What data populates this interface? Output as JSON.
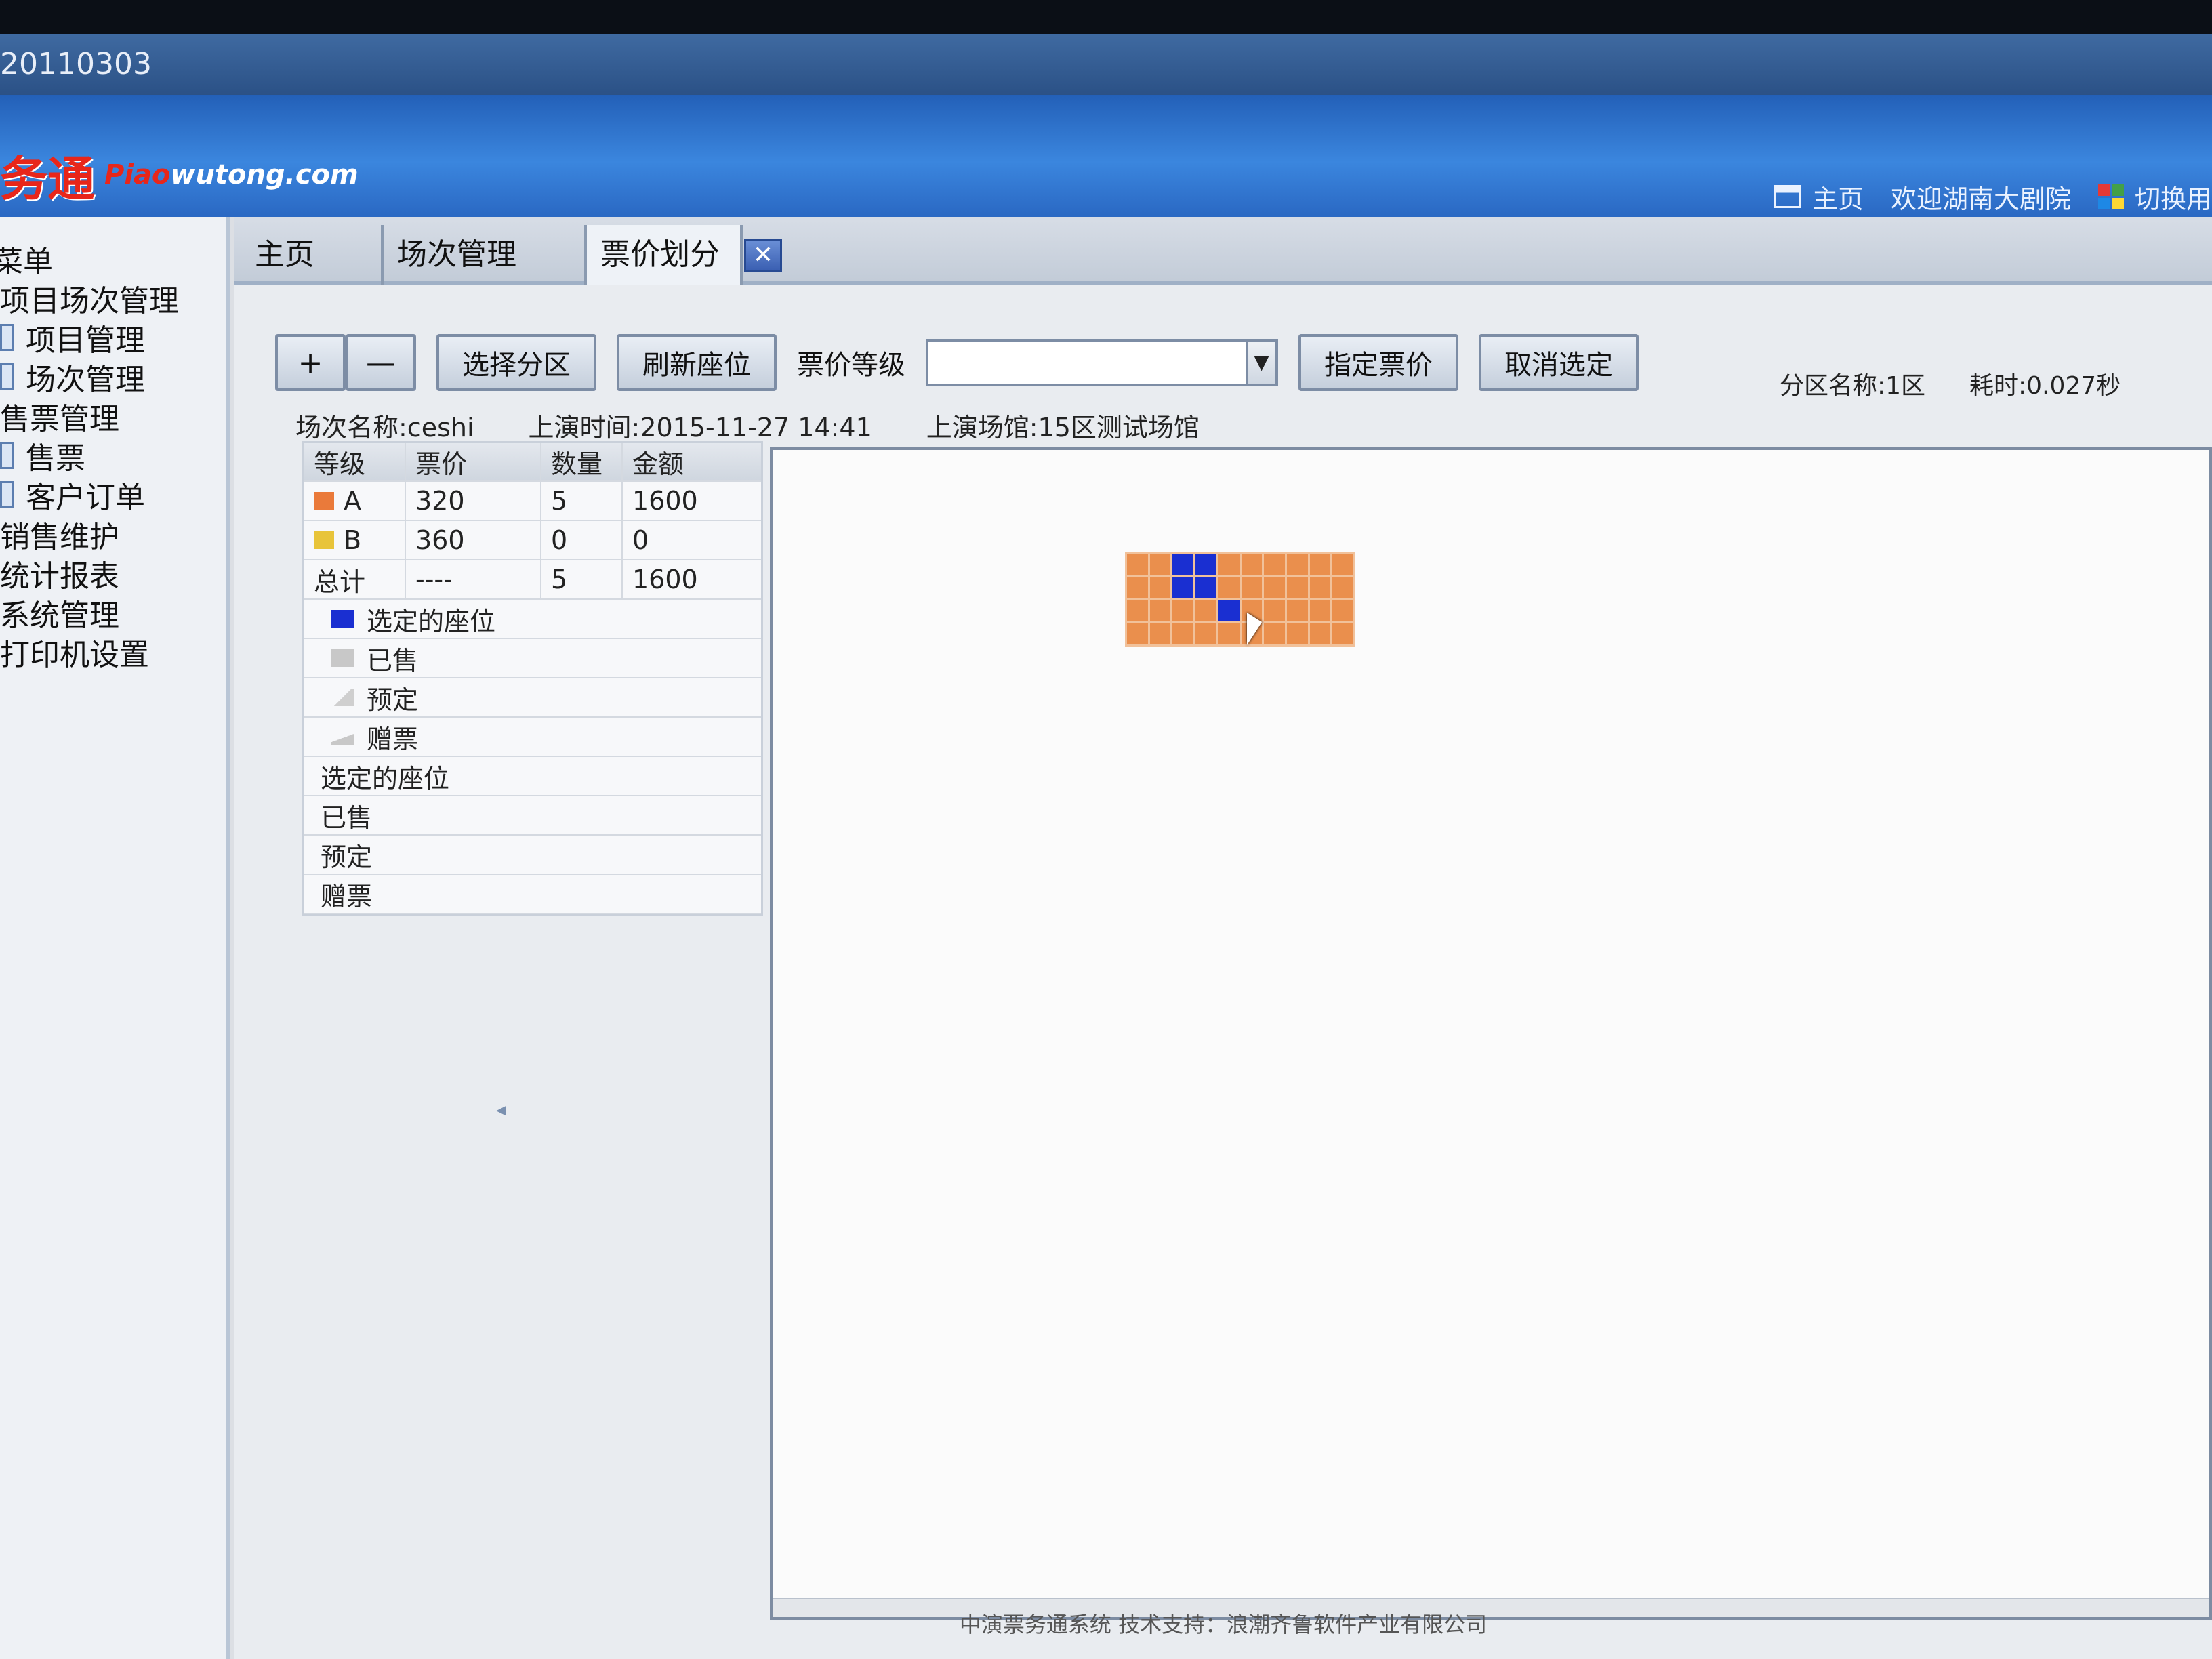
{
  "window": {
    "title": "20110303"
  },
  "brand": {
    "logo_cn": "务通",
    "logo_en_prefix": "Piao",
    "logo_en_rest": "wutong.com"
  },
  "top_nav": {
    "home_label": "主页",
    "welcome": "欢迎湖南大剧院",
    "switch_label": "切换用"
  },
  "sidebar": {
    "items": [
      {
        "label": "菜单"
      },
      {
        "label": "项目场次管理"
      },
      {
        "label": "项目管理"
      },
      {
        "label": "场次管理"
      },
      {
        "label": "售票管理"
      },
      {
        "label": "售票"
      },
      {
        "label": "客户订单"
      },
      {
        "label": "销售维护"
      },
      {
        "label": "统计报表"
      },
      {
        "label": "系统管理"
      },
      {
        "label": "打印机设置"
      }
    ]
  },
  "tabs": [
    {
      "label": "主页"
    },
    {
      "label": "场次管理"
    },
    {
      "label": "票价划分"
    }
  ],
  "toolbar": {
    "plus": "+",
    "minus": "—",
    "select_zone": "选择分区",
    "refresh_seats": "刷新座位",
    "price_level_label": "票价等级",
    "price_level_value": "",
    "assign_price": "指定票价",
    "cancel_selection": "取消选定"
  },
  "status": {
    "zone_name": "分区名称:1区",
    "elapsed": "耗时:0.027秒"
  },
  "session_info": {
    "name": "场次名称:ceshi",
    "time": "上演时间:2015-11-27 14:41",
    "venue": "上演场馆:15区测试场馆"
  },
  "price_table": {
    "headers": [
      "等级",
      "票价",
      "数量",
      "金额"
    ],
    "rows": [
      {
        "level": "A",
        "price": "320",
        "qty": "5",
        "amount": "1600",
        "color": "#ea7a3a"
      },
      {
        "level": "B",
        "price": "360",
        "qty": "0",
        "amount": "0",
        "color": "#e8c43a"
      }
    ],
    "total": {
      "level": "总计",
      "price": "----",
      "qty": "5",
      "amount": "1600"
    }
  },
  "legend": [
    {
      "label": "选定的座位",
      "color": "#1a2fd1"
    },
    {
      "label": "已售",
      "color": "#c8c8c8"
    },
    {
      "label": "预定",
      "color": "#d8d8d8"
    },
    {
      "label": "赠票",
      "color": "#d0d0d0"
    }
  ],
  "legend_plain": [
    "选定的座位",
    "已售",
    "预定",
    "赠票"
  ],
  "seat_map": {
    "rows": 4,
    "cols": 10,
    "selected": [
      [
        0,
        2
      ],
      [
        0,
        3
      ],
      [
        1,
        2
      ],
      [
        1,
        3
      ],
      [
        2,
        4
      ]
    ],
    "seat_color": "#ea8f4d",
    "selected_color": "#1a2fd1"
  },
  "footer": {
    "text": "中演票务通系统  技术支持：浪潮齐鲁软件产业有限公司"
  }
}
